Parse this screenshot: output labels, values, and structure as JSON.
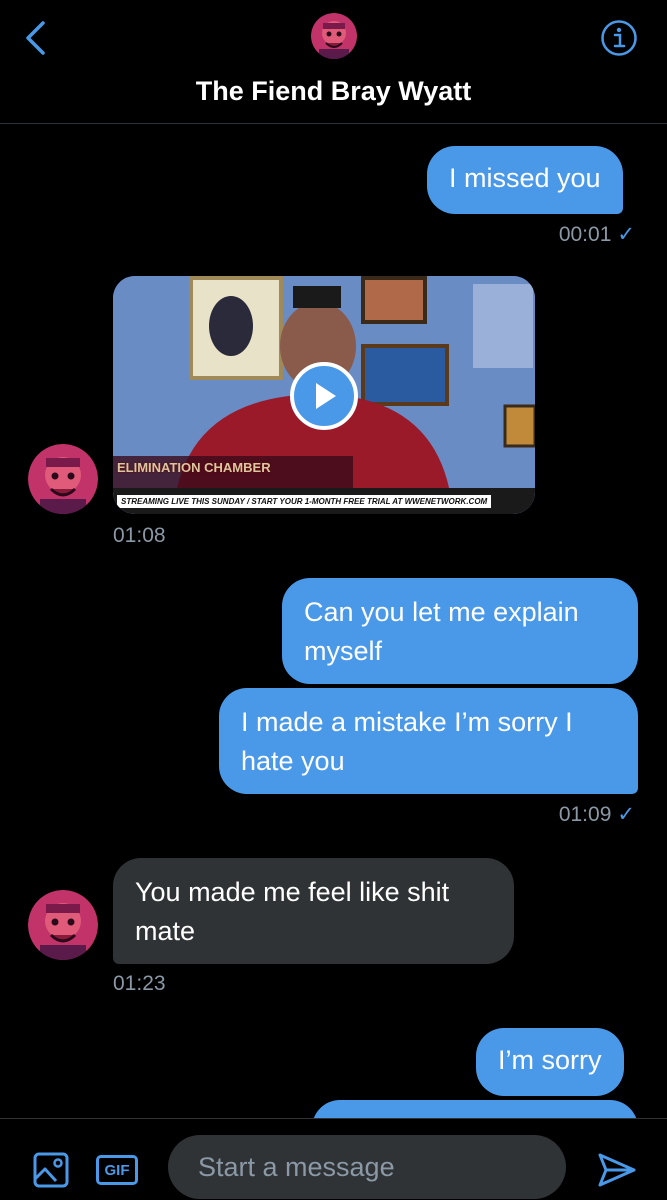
{
  "header": {
    "title": "The Fiend Bray Wyatt",
    "back_icon": "chevron-left-icon",
    "info_icon": "info-icon"
  },
  "messages": [
    {
      "direction": "outgoing",
      "text": "I missed you",
      "time": "00:01",
      "read": true
    },
    {
      "direction": "incoming",
      "type": "video",
      "time": "01:08",
      "video": {
        "banner": "STREAMING LIVE THIS SUNDAY / START YOUR 1-MONTH FREE TRIAL AT WWENETWORK.COM",
        "event_logo": "ELIMINATION CHAMBER"
      }
    },
    {
      "direction": "outgoing",
      "text": "Can you let me explain myself"
    },
    {
      "direction": "outgoing",
      "text": "I made a mistake I’m sorry I hate you",
      "time": "01:09",
      "read": true
    },
    {
      "direction": "incoming",
      "text": "You made me feel like shit mate",
      "time": "01:23"
    },
    {
      "direction": "outgoing",
      "text": "I’m sorry"
    }
  ],
  "composer": {
    "placeholder": "Start a message",
    "gif_label": "GIF",
    "image_icon": "image-icon",
    "send_icon": "send-icon"
  },
  "colors": {
    "accent": "#4a99e9",
    "incoming_bubble": "#2f3336",
    "background": "#000000",
    "timestamp": "#8b98a5"
  }
}
